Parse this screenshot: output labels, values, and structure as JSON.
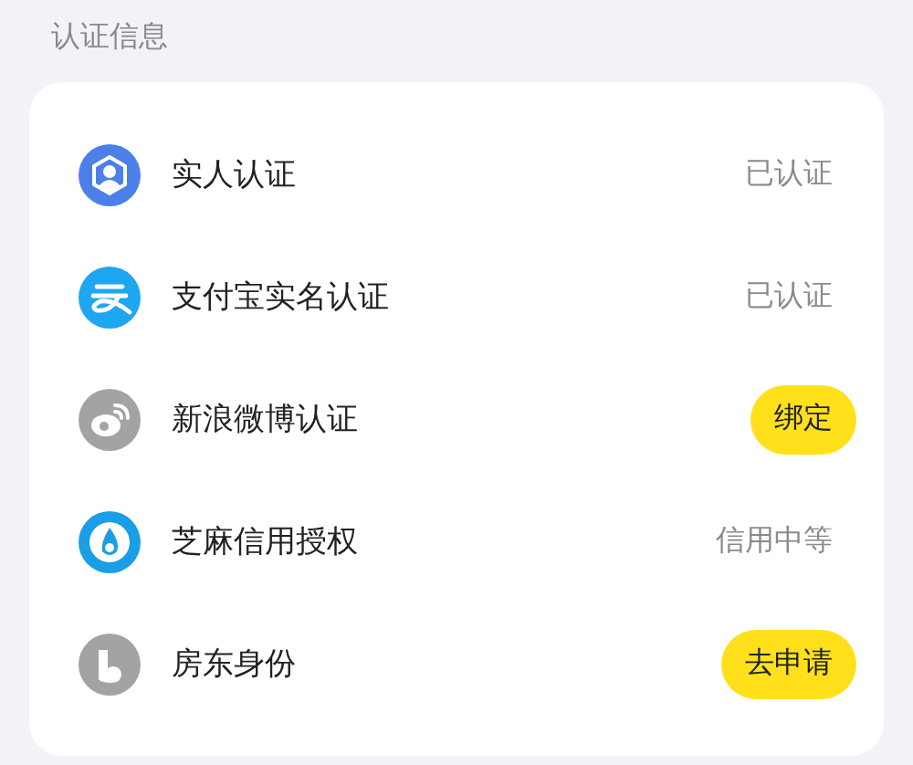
{
  "section_title": "认证信息",
  "items": [
    {
      "label": "实人认证",
      "kind": "status",
      "value": "已认证"
    },
    {
      "label": "支付宝实名认证",
      "kind": "status",
      "value": "已认证"
    },
    {
      "label": "新浪微博认证",
      "kind": "button",
      "value": "绑定"
    },
    {
      "label": "芝麻信用授权",
      "kind": "status",
      "value": "信用中等"
    },
    {
      "label": "房东身份",
      "kind": "button",
      "value": "去申请"
    }
  ]
}
